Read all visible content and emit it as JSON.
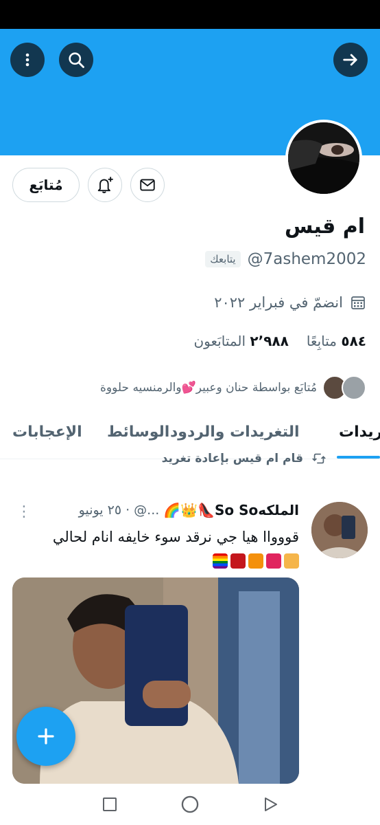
{
  "colors": {
    "accent": "#1da1f2",
    "text": "#0f1419",
    "muted": "#536471",
    "border": "#cfd9de"
  },
  "header": {
    "back_icon": "arrow-right-icon",
    "search_icon": "search-icon",
    "more_icon": "more-vertical-icon"
  },
  "profile": {
    "name": "ام قيس",
    "handle": "@7ashem2002",
    "follows_you": "يتابعك",
    "joined": "انضمّ في فبراير ٢٠٢٢",
    "following_count": "٥٨٤",
    "following_label": "متابِعًا",
    "followers_count": "٢٬٩٨٨",
    "followers_label": "المتابَعون",
    "followed_by": "مُتابَع بواسطة حنان وعبير💕والرمنسيه حلووة"
  },
  "actions": {
    "follow_label": "مُتابَع",
    "notify_icon": "bell-plus-icon",
    "message_icon": "mail-icon"
  },
  "tabs": [
    {
      "label": "ريدات",
      "active": true
    },
    {
      "label": "التغريدات والردود",
      "active": false
    },
    {
      "label": "الوسائط",
      "active": false
    },
    {
      "label": "الإعجابات",
      "active": false
    }
  ],
  "tweet": {
    "retweeted_by": "قام ام قيس بإعادة تغريد",
    "author_name": "الملكهSo So👠👑🌈",
    "author_meta": "...@ · ٢٥ يونيو",
    "text": "قووواا هيا جي نرقد سوء خايفه انام لحالي",
    "emoji_line": "😭💋🔥👠🏳️‍🌈"
  },
  "system_nav": {
    "recents_icon": "square-icon",
    "home_icon": "circle-icon",
    "back_icon": "triangle-back-icon"
  },
  "fab_icon": "plus-icon"
}
